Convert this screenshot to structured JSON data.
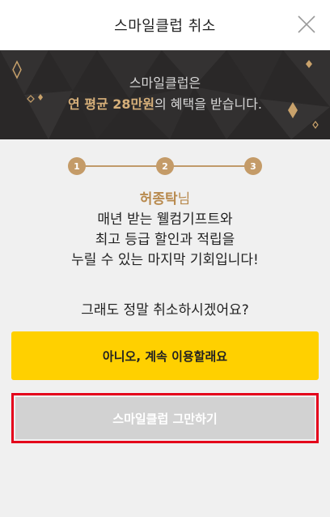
{
  "header": {
    "title": "스마일클럽 취소",
    "close_icon": "close-icon"
  },
  "banner": {
    "line1": "스마일클럽은",
    "line2_highlight": "연 평균 28만원",
    "line2_rest": "의 혜택을 받습니다."
  },
  "stepper": {
    "steps": [
      "1",
      "2",
      "3"
    ]
  },
  "message": {
    "name": "허종탁",
    "honorific": "님",
    "line1": "매년 받는 웰컴기프트와",
    "line2": "최고 등급 할인과 적립을",
    "line3": "누릴 수 있는 마지막 기회입니다!"
  },
  "question": "그래도 정말 취소하시겠어요?",
  "buttons": {
    "keep": "아니오, 계속 이용할래요",
    "quit": "스마일클럽 그만하기"
  },
  "colors": {
    "accent_gold": "#c49b68",
    "keep_button": "#ffd000",
    "quit_button": "#d2d2d2",
    "highlight_border": "#e4001b"
  }
}
